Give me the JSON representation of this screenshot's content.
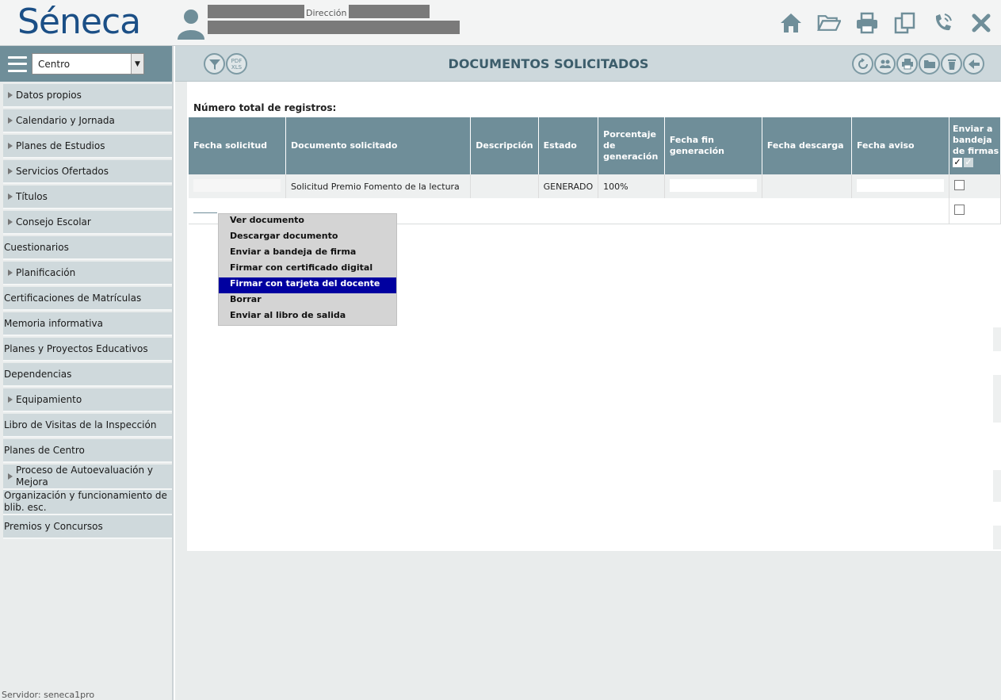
{
  "header": {
    "logo_text": "Séneca",
    "direction_label": "Dirección",
    "icons": [
      "home-icon",
      "folder-open-icon",
      "printer-icon",
      "copy-icon",
      "phone-icon",
      "close-icon"
    ]
  },
  "sidebar": {
    "select_value": "Centro",
    "items": [
      {
        "label": "Datos propios",
        "expandable": true
      },
      {
        "label": "Calendario y Jornada",
        "expandable": true
      },
      {
        "label": "Planes de Estudios",
        "expandable": true
      },
      {
        "label": "Servicios Ofertados",
        "expandable": true
      },
      {
        "label": "Títulos",
        "expandable": true
      },
      {
        "label": "Consejo Escolar",
        "expandable": true
      },
      {
        "label": "Cuestionarios",
        "expandable": false
      },
      {
        "label": "Planificación",
        "expandable": true
      },
      {
        "label": "Certificaciones de Matrículas",
        "expandable": false
      },
      {
        "label": "Memoria informativa",
        "expandable": false
      },
      {
        "label": "Planes y Proyectos Educativos",
        "expandable": false
      },
      {
        "label": "Dependencias",
        "expandable": false
      },
      {
        "label": "Equipamiento",
        "expandable": true
      },
      {
        "label": "Libro de Visitas de la Inspección",
        "expandable": false
      },
      {
        "label": "Planes de Centro",
        "expandable": false
      },
      {
        "label": "Proceso de Autoevaluación y Mejora",
        "expandable": true
      },
      {
        "label": "Organización y funcionamiento de blib. esc.",
        "expandable": false
      },
      {
        "label": "Premios y Concursos",
        "expandable": false
      }
    ],
    "footer": "Servidor: seneca1pro"
  },
  "toolbar": {
    "title": "DOCUMENTOS SOLICITADOS",
    "left_icons": [
      "filter-icon",
      "pdf-xls-icon"
    ],
    "right_icons": [
      "refresh-icon",
      "users-icon",
      "print-icon",
      "folder-icon",
      "trash-icon",
      "back-icon"
    ]
  },
  "content": {
    "total_label": "Número total de registros:",
    "columns": [
      "Fecha solicitud",
      "Documento solicitado",
      "Descripción",
      "Estado",
      "Porcentaje de generación",
      "Fecha fin generación",
      "Fecha descarga",
      "Fecha aviso",
      "Enviar a bandeja de firmas"
    ],
    "rows": [
      {
        "documento": "Solicitud Premio Fomento de la lectura",
        "descripcion": "",
        "estado": "GENERADO",
        "porcentaje": "100%",
        "fecha_descarga": ""
      }
    ]
  },
  "context_menu": {
    "items": [
      {
        "label": "Ver documento",
        "selected": false
      },
      {
        "label": "Descargar documento",
        "selected": false
      },
      {
        "label": "Enviar a bandeja de firma",
        "selected": false
      },
      {
        "label": "Firmar con certificado digital",
        "selected": false
      },
      {
        "label": "Firmar con tarjeta del docente",
        "selected": true
      },
      {
        "label": "Borrar",
        "selected": false
      },
      {
        "label": "Enviar al libro de salida",
        "selected": false
      }
    ]
  },
  "colors": {
    "accent": "#6f8e99",
    "selected": "#0000a0",
    "logo": "#1b4f86"
  }
}
